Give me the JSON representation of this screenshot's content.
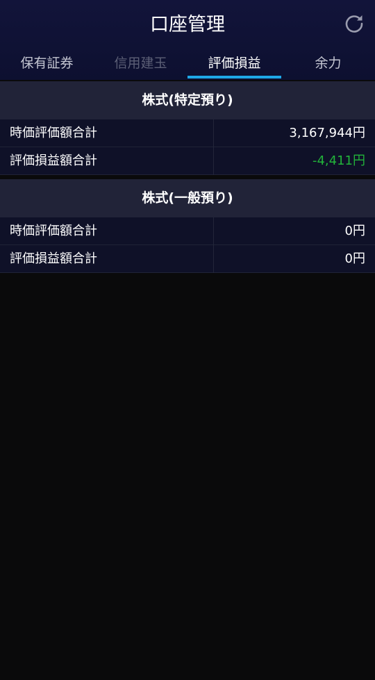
{
  "header": {
    "title": "口座管理",
    "refresh_icon": "refresh-icon"
  },
  "tabs": [
    {
      "label": "保有証券",
      "state": "normal"
    },
    {
      "label": "信用建玉",
      "state": "disabled"
    },
    {
      "label": "評価損益",
      "state": "active"
    },
    {
      "label": "余力",
      "state": "normal"
    }
  ],
  "sections": [
    {
      "title": "株式(特定預り)",
      "rows": [
        {
          "label": "時価評価額合計",
          "value": "3,167,944円"
        },
        {
          "label": "評価損益額合計",
          "value": "-4,411円"
        }
      ]
    },
    {
      "title": "株式(一般預り)",
      "rows": [
        {
          "label": "時価評価額合計",
          "value": "0円"
        },
        {
          "label": "評価損益額合計",
          "value": "0円"
        }
      ]
    }
  ],
  "colors": {
    "accent": "#1ea7e8",
    "negative": "#22b43a",
    "header_bg": "#12143a",
    "section_bg": "#212338",
    "row_bg": "#0f1128",
    "page_bg": "#0a0a0b"
  }
}
